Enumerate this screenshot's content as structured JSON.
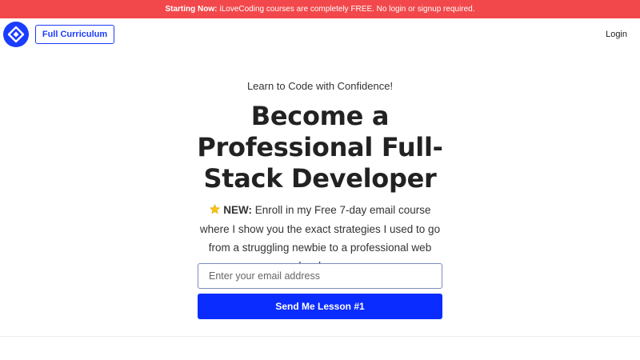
{
  "banner": {
    "bold": "Starting Now:",
    "text": "iLoveCoding courses are completely FREE. No login or signup required."
  },
  "header": {
    "logo_icon": "diamond-logo-icon",
    "curriculum_label": "Full Curriculum",
    "login_label": "Login"
  },
  "hero": {
    "tagline": "Learn to Code with Confidence!",
    "headline": "Become a Professional Full-Stack Developer",
    "badge_icon": "star-icon",
    "badge": "NEW:",
    "description": "Enroll in my Free 7-day email course where I show you the exact strategies I used to go from a struggling newbie to a professional web developer."
  },
  "form": {
    "email_placeholder": "Enter your email address",
    "email_value": "",
    "submit_label": "Send Me Lesson #1"
  },
  "colors": {
    "banner": "#f2484b",
    "brand": "#1a3cff",
    "button": "#0a2cff"
  }
}
